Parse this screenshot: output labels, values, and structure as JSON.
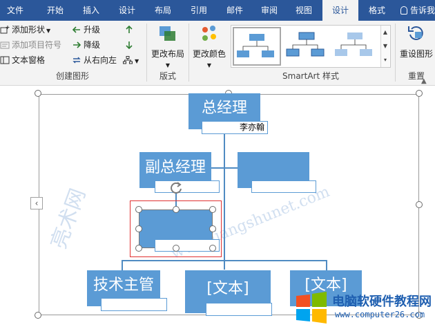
{
  "tabs": [
    {
      "label": "文件",
      "active": false
    },
    {
      "label": "开始",
      "active": false
    },
    {
      "label": "插入",
      "active": false
    },
    {
      "label": "设计",
      "active": false
    },
    {
      "label": "布局",
      "active": false
    },
    {
      "label": "引用",
      "active": false
    },
    {
      "label": "邮件",
      "active": false
    },
    {
      "label": "审阅",
      "active": false
    },
    {
      "label": "视图",
      "active": false
    },
    {
      "label": "设计",
      "active": true
    },
    {
      "label": "格式",
      "active": false
    }
  ],
  "tell_me": "告诉我",
  "ribbon": {
    "create_graphic": {
      "add_shape": "添加形状",
      "add_bullet": "添加项目符号",
      "text_pane": "文本窗格",
      "promote": "升级",
      "demote": "降级",
      "right_to_left": "从右向左",
      "label": "创建图形"
    },
    "layouts": {
      "change_layout": "更改布局",
      "label": "版式"
    },
    "styles": {
      "change_colors": "更改颜色",
      "label": "SmartArt 样式"
    },
    "reset": {
      "reset_graphic": "重设图形",
      "label": "重置"
    }
  },
  "colors": {
    "tab_bar": "#2b579a",
    "shape_fill": "#5b9bd5",
    "selection_red": "#e03030"
  },
  "diagram": {
    "top": {
      "text": "总经理",
      "sub": "李亦翰"
    },
    "deputy": {
      "text": "副总经理",
      "sub": ""
    },
    "assistant": {
      "text": "",
      "sub": ""
    },
    "selected": {
      "text": "",
      "sub": ""
    },
    "children": [
      {
        "text": "技术主管",
        "sub": ""
      },
      {
        "text": "[文本]",
        "sub": ""
      },
      {
        "text": "[文本]",
        "sub": ""
      }
    ]
  },
  "logo": {
    "name": "电脑软硬件教程网",
    "url": "www.computer26.com"
  }
}
